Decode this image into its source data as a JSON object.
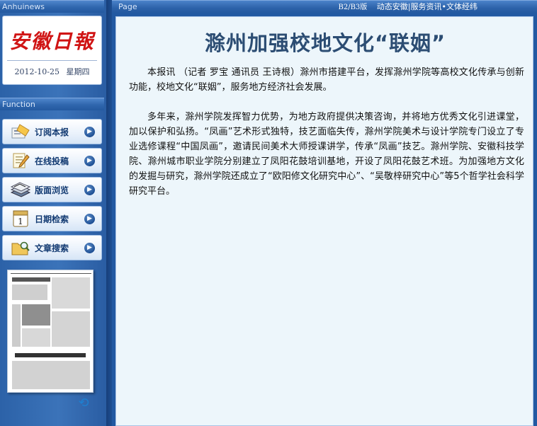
{
  "left_header": {
    "label": "Anhuinews"
  },
  "masthead": {
    "logo_text": "安徽日報",
    "date": "2012-10-25",
    "weekday": "星期四"
  },
  "function_panel": {
    "label": "Function",
    "items": [
      {
        "label": "订阅本报",
        "icon": "newspaper-subscribe-icon"
      },
      {
        "label": "在线投稿",
        "icon": "pencil-paper-icon"
      },
      {
        "label": "版面浏览",
        "icon": "stacked-pages-icon"
      },
      {
        "label": "日期检索",
        "icon": "calendar-icon"
      },
      {
        "label": "文章搜索",
        "icon": "folder-search-icon"
      }
    ]
  },
  "topbar": {
    "label": "Page",
    "edition": "B2/B3版",
    "section_links": "动态安徽|服务资讯•文体经纬"
  },
  "article": {
    "title": "滁州加强校地文化“联姻”",
    "paragraphs": [
      "本报讯 （记者 罗宝 通讯员 王诗根）滁州市搭建平台，发挥滁州学院等高校文化传承与创新功能，校地文化“联姻”，服务地方经济社会发展。",
      "多年来，滁州学院发挥智力优势，为地方政府提供决策咨询，并将地方优秀文化引进课堂，加以保护和弘扬。“凤画”艺术形式独特，技艺面临失传，滁州学院美术与设计学院专门设立了专业选修课程“中国凤画”，邀请民间美术大师授课讲学，传承“凤画”技艺。滁州学院、安徽科技学院、滁州城市职业学院分别建立了凤阳花鼓培训基地，开设了凤阳花鼓艺术班。为加强地方文化的发掘与研究，滁州学院还成立了“欧阳修文化研究中心”、“吴敬梓研究中心”等5个哲学社会科学研究平台。"
    ]
  },
  "colors": {
    "frame_blue": "#2259a2",
    "content_bg": "#edf6fb",
    "title_color": "#2c4d73",
    "logo_red": "#d01414"
  }
}
